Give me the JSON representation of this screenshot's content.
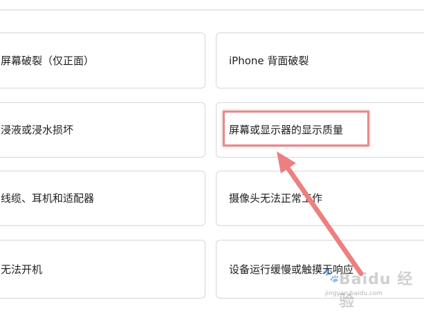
{
  "issues": [
    {
      "label": "屏幕破裂（仅正面）"
    },
    {
      "label": "iPhone 背面破裂"
    },
    {
      "label": "浸液或浸水损坏"
    },
    {
      "label": "屏幕或显示器的显示质量"
    },
    {
      "label": "线缆、耳机和适配器"
    },
    {
      "label": "摄像头无法正常工作"
    },
    {
      "label": "无法开机"
    },
    {
      "label": "设备运行缓慢或触摸无响应"
    }
  ],
  "annotation": {
    "highlight_color": "#e8898a",
    "arrow_color": "#ec8080",
    "highlighted_item": "屏幕或显示器的显示质量"
  },
  "watermark": {
    "text": "Baidu 经验",
    "url": "jingyan.baidu.com"
  }
}
